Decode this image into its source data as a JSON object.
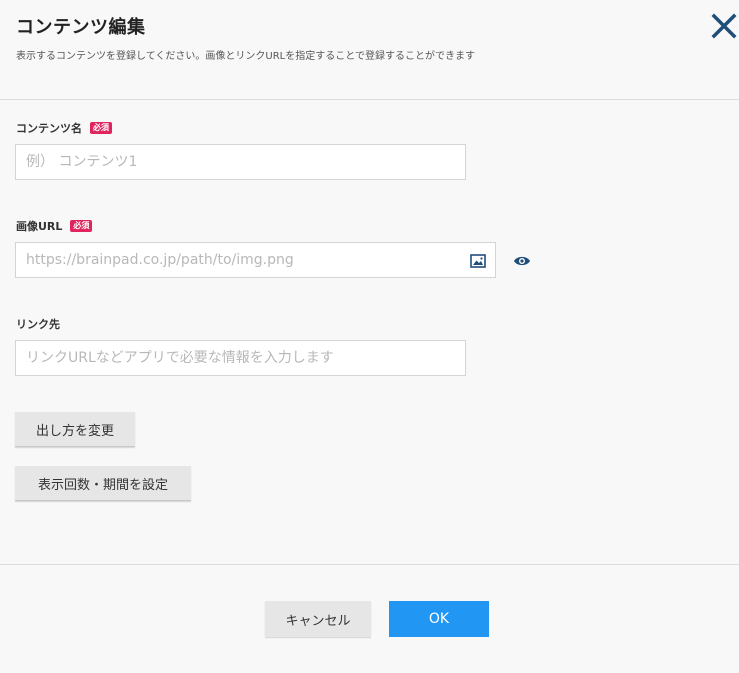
{
  "dialog": {
    "title": "コンテンツ編集",
    "subtitle": "表示するコンテンツを登録してください。画像とリンクURLを指定することで登録することができます"
  },
  "fields": {
    "content_name": {
      "label": "コンテンツ名",
      "required_badge": "必須",
      "placeholder": "例） コンテンツ1",
      "value": ""
    },
    "image_url": {
      "label": "画像URL",
      "required_badge": "必須",
      "placeholder": "https://brainpad.co.jp/path/to/img.png",
      "value": "",
      "icons": [
        "image-icon",
        "eye-icon"
      ]
    },
    "link": {
      "label": "リンク先",
      "placeholder": "リンクURLなどアプリで必要な情報を入力します",
      "value": ""
    }
  },
  "buttons": {
    "change_display": "出し方を変更",
    "set_period": "表示回数・期間を設定",
    "cancel": "キャンセル",
    "ok": "OK"
  },
  "colors": {
    "accent": "#2196f3",
    "close_icon": "#1f4e79",
    "required_badge": "#e0245e",
    "eye_icon": "#1f4e79"
  }
}
